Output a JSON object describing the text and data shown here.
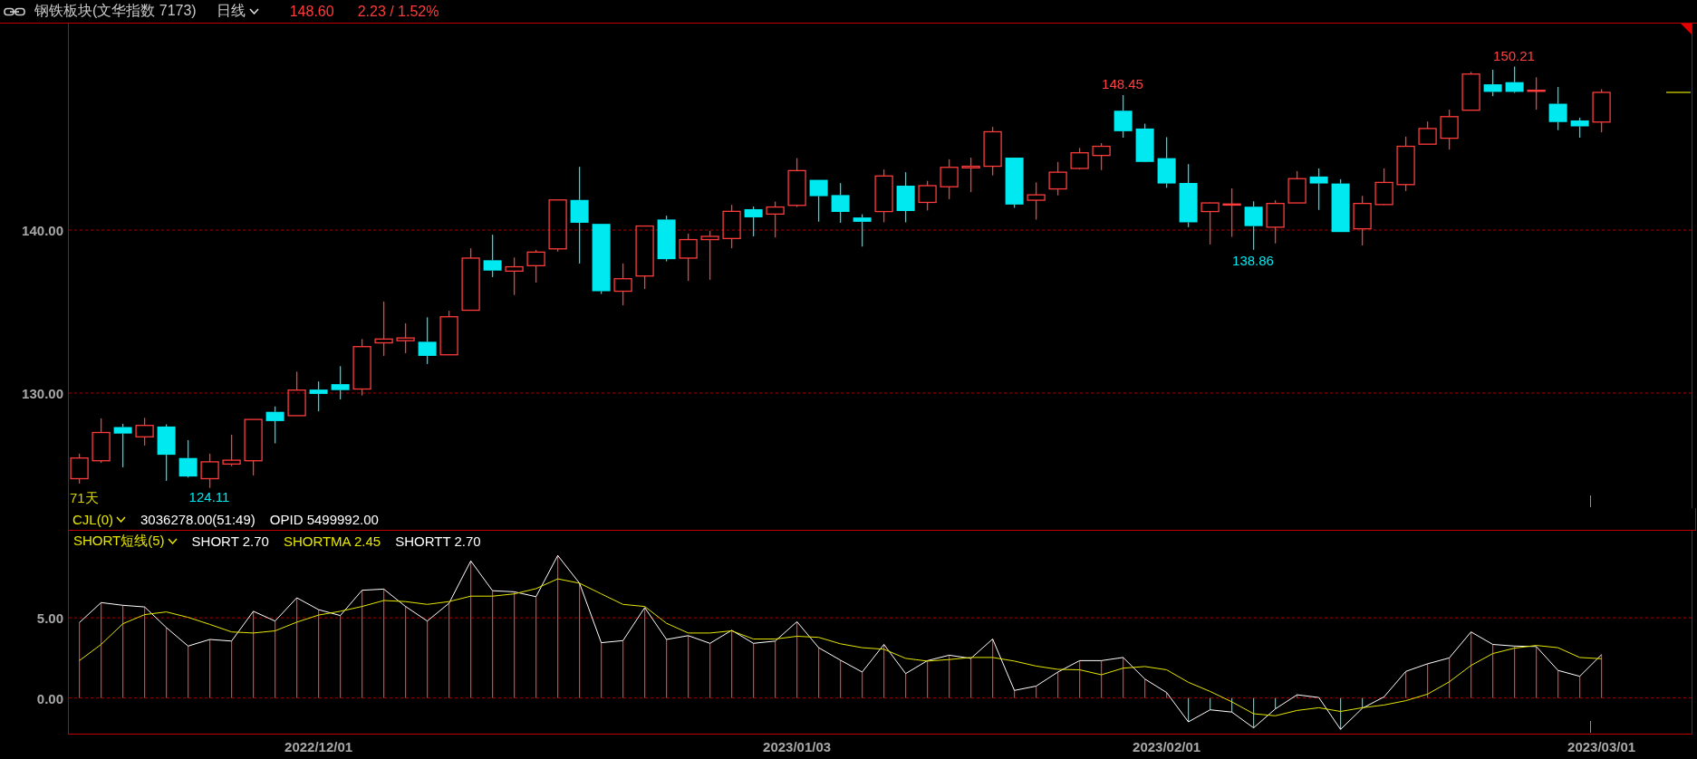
{
  "header": {
    "title": "钢铁板块(文华指数 7173)",
    "period": "日线",
    "price": "148.60",
    "change": "2.23 / 1.52%"
  },
  "main_chart": {
    "y_labels": [
      "140.00",
      "130.00"
    ],
    "bar_count": "71天",
    "annotations": [
      {
        "text": "124.11",
        "kind": "low"
      },
      {
        "text": "148.45",
        "kind": "high"
      },
      {
        "text": "138.86",
        "kind": "low"
      },
      {
        "text": "150.21",
        "kind": "high"
      }
    ]
  },
  "volume_row": {
    "indicator": "CJL(0)",
    "value": "3036278.00(51:49)",
    "opid": "OPID 5499992.00"
  },
  "short_panel": {
    "indicator": "SHORT短线(5)",
    "legend": [
      {
        "kind": "series",
        "value": "2.70"
      },
      {
        "kind": "series",
        "value": "2.45"
      },
      {
        "kind": "extra",
        "label": "SHORTT",
        "value": "2.70",
        "color": "#ffffff"
      }
    ],
    "chart_data": {
      "type": "line",
      "categories": [
        null,
        null,
        null,
        null,
        null,
        null,
        null,
        null,
        null,
        null,
        null,
        "2022/12/01",
        null,
        null,
        null,
        null,
        null,
        null,
        null,
        null,
        null,
        null,
        null,
        null,
        null,
        null,
        null,
        null,
        null,
        null,
        null,
        null,
        null,
        "2023/01/03",
        null,
        null,
        null,
        null,
        null,
        null,
        null,
        null,
        null,
        null,
        null,
        null,
        null,
        null,
        null,
        null,
        "2023/02/01",
        null,
        null,
        null,
        null,
        null,
        null,
        null,
        null,
        null,
        null,
        null,
        null,
        null,
        null,
        null,
        null,
        null,
        null,
        null,
        "2023/03/01"
      ],
      "series": [
        {
          "name": "SHORT",
          "color": "#ffffff",
          "values": [
            4.7,
            5.95,
            5.78,
            5.68,
            4.39,
            3.24,
            3.65,
            3.55,
            5.41,
            4.8,
            6.25,
            5.51,
            5.14,
            6.72,
            6.79,
            5.71,
            4.8,
            5.91,
            8.55,
            6.69,
            6.62,
            6.32,
            8.89,
            7.16,
            3.45,
            3.58,
            5.64,
            3.65,
            3.89,
            3.41,
            4.22,
            3.41,
            3.55,
            4.76,
            3.14,
            2.36,
            1.62,
            3.34,
            1.52,
            2.33,
            2.67,
            2.47,
            3.68,
            0.47,
            0.74,
            1.62,
            2.33,
            2.33,
            2.53,
            1.18,
            0.34,
            -1.49,
            -0.74,
            -0.88,
            -1.86,
            -0.68,
            0.2,
            0.03,
            -1.96,
            -0.64,
            0.07,
            1.66,
            2.13,
            2.5,
            4.12,
            3.34,
            3.24,
            3.21,
            1.72,
            1.35,
            2.7
          ]
        },
        {
          "name": "SHORTMA",
          "color": "#e6e600",
          "values": [
            2.33,
            3.34,
            4.63,
            5.2,
            5.37,
            5.03,
            4.59,
            4.12,
            4.05,
            4.19,
            4.73,
            5.17,
            5.41,
            5.71,
            6.08,
            6.01,
            5.84,
            6.01,
            6.35,
            6.35,
            6.49,
            6.82,
            7.43,
            7.16,
            6.49,
            5.84,
            5.71,
            4.66,
            4.05,
            4.05,
            4.19,
            3.68,
            3.68,
            3.85,
            3.78,
            3.38,
            3.14,
            3.04,
            2.47,
            2.3,
            2.4,
            2.53,
            2.53,
            2.3,
            1.99,
            1.79,
            1.76,
            1.45,
            1.86,
            1.96,
            1.76,
            0.98,
            0.41,
            -0.24,
            -0.98,
            -1.11,
            -0.78,
            -0.61,
            -0.84,
            -0.61,
            -0.44,
            -0.17,
            0.24,
            1.01,
            2.03,
            2.77,
            3.11,
            3.28,
            3.14,
            2.53,
            2.45
          ]
        },
        {
          "type": "bar",
          "color": "#ff3030",
          "values": [
            4.7,
            5.95,
            5.78,
            5.68,
            4.39,
            3.24,
            3.65,
            3.55,
            5.41,
            4.8,
            6.25,
            5.51,
            5.14,
            6.72,
            6.79,
            5.71,
            4.8,
            5.91,
            8.55,
            6.69,
            6.62,
            6.32,
            8.89,
            7.16,
            3.45,
            3.58,
            5.64,
            3.65,
            3.89,
            3.41,
            4.22,
            3.41,
            3.55,
            4.76,
            3.14,
            2.36,
            1.62,
            3.34,
            1.52,
            2.33,
            2.67,
            2.47,
            3.68,
            0.47,
            0.74,
            1.62,
            2.33,
            2.33,
            2.53,
            1.18,
            0.34,
            null,
            null,
            null,
            null,
            null,
            0.2,
            null,
            null,
            null,
            0.07,
            1.66,
            2.13,
            2.5,
            4.12,
            3.34,
            3.24,
            3.21,
            1.72,
            1.35,
            2.7
          ]
        },
        {
          "type": "bar",
          "color": "#00e8f0",
          "values": [
            null,
            null,
            null,
            null,
            null,
            null,
            null,
            null,
            null,
            null,
            null,
            null,
            null,
            null,
            null,
            null,
            null,
            null,
            null,
            null,
            null,
            null,
            null,
            null,
            null,
            null,
            null,
            null,
            null,
            null,
            null,
            null,
            null,
            null,
            null,
            null,
            null,
            null,
            null,
            null,
            null,
            null,
            null,
            null,
            null,
            null,
            null,
            null,
            null,
            null,
            null,
            -1.49,
            -0.74,
            -0.88,
            -1.86,
            -0.68,
            null,
            null,
            -1.96,
            -0.64,
            null,
            null,
            null,
            null,
            null,
            null,
            null,
            null,
            null,
            null,
            null
          ]
        }
      ],
      "ylim": [
        -2.28,
        10.43
      ],
      "yticks": [
        {
          "value": 0,
          "label": "0.00"
        },
        {
          "value": 5,
          "label": "5.00"
        }
      ]
    }
  }
}
